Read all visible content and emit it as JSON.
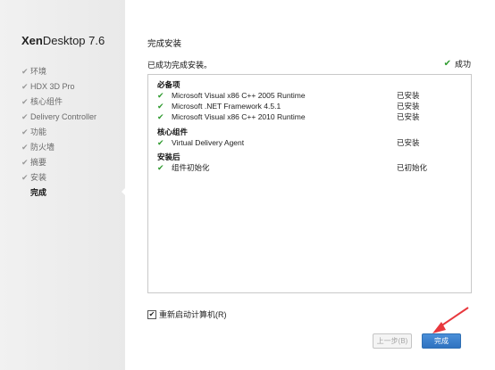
{
  "brand": {
    "part1": "Xen",
    "part2": "Desktop 7.6"
  },
  "sidebar": {
    "steps": [
      {
        "label": "环境",
        "done": true
      },
      {
        "label": "HDX 3D Pro",
        "done": true
      },
      {
        "label": "核心组件",
        "done": true
      },
      {
        "label": "Delivery Controller",
        "done": true
      },
      {
        "label": "功能",
        "done": true
      },
      {
        "label": "防火墙",
        "done": true
      },
      {
        "label": "摘要",
        "done": true
      },
      {
        "label": "安装",
        "done": true
      },
      {
        "label": "完成",
        "done": false
      }
    ]
  },
  "main": {
    "title": "完成安装",
    "subtitle": "已成功完成安装。",
    "status": "成功",
    "groups": [
      {
        "title": "必备项",
        "items": [
          {
            "name": "Microsoft Visual x86 C++ 2005 Runtime",
            "status": "已安装"
          },
          {
            "name": "Microsoft .NET Framework 4.5.1",
            "status": "已安装"
          },
          {
            "name": "Microsoft Visual x86 C++ 2010 Runtime",
            "status": "已安装"
          }
        ]
      },
      {
        "title": "核心组件",
        "items": [
          {
            "name": "Virtual Delivery Agent",
            "status": "已安装"
          }
        ]
      },
      {
        "title": "安装后",
        "items": [
          {
            "name": "组件初始化",
            "status": "已初始化"
          }
        ]
      }
    ],
    "restart_label": "重新启动计算机(R)",
    "restart_checked": true
  },
  "buttons": {
    "back": "上一步(B)",
    "finish": "完成"
  },
  "colors": {
    "check": "#2e9a2e",
    "accent": "#2f72c0",
    "annotation": "#e8383d"
  }
}
